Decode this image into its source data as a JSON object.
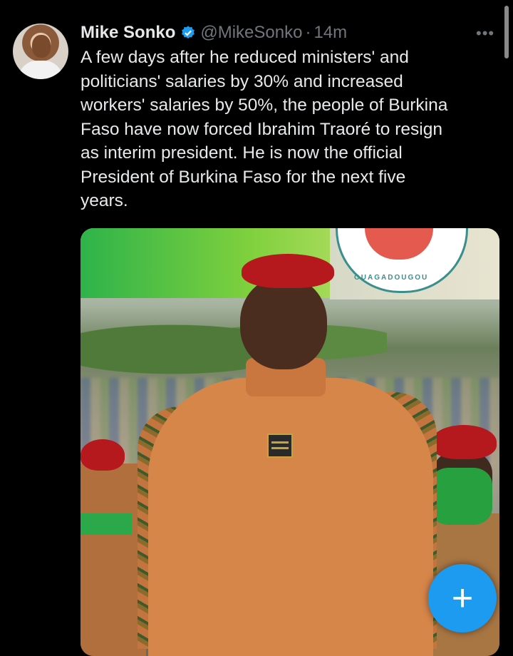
{
  "tweet": {
    "author_name": "Mike Sonko",
    "handle": "@MikeSonko",
    "separator": "·",
    "time": "14m",
    "more_label": "•••",
    "text": "A few days after he reduced ministers' and\npoliticians' salaries by 30% and increased\nworkers' salaries by 50%, the people of Burkina\nFaso have now forced Ibrahim Traoré to resign\nas interim president. He is now the official\nPresident of Burkina Faso for the next five\nyears.",
    "verified": true
  },
  "media": {
    "emblem_text": "OUAGADOUGOU"
  },
  "compose_fab": {
    "icon": "plus-icon",
    "label": "+"
  },
  "colors": {
    "background": "#000000",
    "primary_text": "#e7e9ea",
    "secondary_text": "#71767b",
    "accent": "#1d9bf0"
  }
}
